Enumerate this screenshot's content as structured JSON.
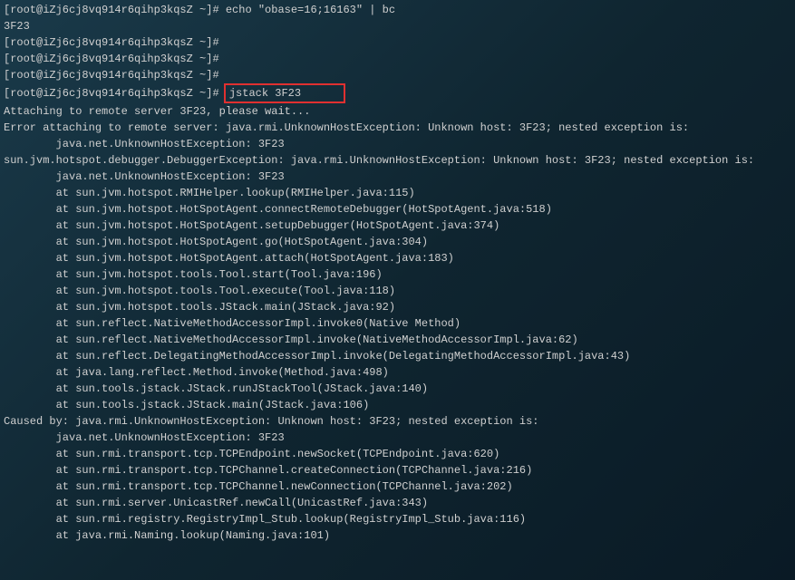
{
  "prompt": {
    "user_host": "[root@iZj6cj8vq914r6qihp3kqsZ ~]#",
    "cmd1": "echo \"obase=16;16163\" | bc",
    "output1": "3F23",
    "highlighted_cmd": "jstack 3F23      "
  },
  "output": {
    "attaching": "Attaching to remote server 3F23, please wait...",
    "error1": "Error attaching to remote server: java.rmi.UnknownHostException: Unknown host: 3F23; nested exception is:",
    "indent_exc": "        java.net.UnknownHostException: 3F23",
    "error2": "sun.jvm.hotspot.debugger.DebuggerException: java.rmi.UnknownHostException: Unknown host: 3F23; nested exception is:",
    "traces": [
      "        at sun.jvm.hotspot.RMIHelper.lookup(RMIHelper.java:115)",
      "        at sun.jvm.hotspot.HotSpotAgent.connectRemoteDebugger(HotSpotAgent.java:518)",
      "        at sun.jvm.hotspot.HotSpotAgent.setupDebugger(HotSpotAgent.java:374)",
      "        at sun.jvm.hotspot.HotSpotAgent.go(HotSpotAgent.java:304)",
      "        at sun.jvm.hotspot.HotSpotAgent.attach(HotSpotAgent.java:183)",
      "        at sun.jvm.hotspot.tools.Tool.start(Tool.java:196)",
      "        at sun.jvm.hotspot.tools.Tool.execute(Tool.java:118)",
      "        at sun.jvm.hotspot.tools.JStack.main(JStack.java:92)",
      "        at sun.reflect.NativeMethodAccessorImpl.invoke0(Native Method)",
      "        at sun.reflect.NativeMethodAccessorImpl.invoke(NativeMethodAccessorImpl.java:62)",
      "        at sun.reflect.DelegatingMethodAccessorImpl.invoke(DelegatingMethodAccessorImpl.java:43)",
      "        at java.lang.reflect.Method.invoke(Method.java:498)",
      "        at sun.tools.jstack.JStack.runJStackTool(JStack.java:140)",
      "        at sun.tools.jstack.JStack.main(JStack.java:106)"
    ],
    "caused_by": "Caused by: java.rmi.UnknownHostException: Unknown host: 3F23; nested exception is:",
    "traces2": [
      "        at sun.rmi.transport.tcp.TCPEndpoint.newSocket(TCPEndpoint.java:620)",
      "        at sun.rmi.transport.tcp.TCPChannel.createConnection(TCPChannel.java:216)",
      "        at sun.rmi.transport.tcp.TCPChannel.newConnection(TCPChannel.java:202)",
      "        at sun.rmi.server.UnicastRef.newCall(UnicastRef.java:343)",
      "        at sun.rmi.registry.RegistryImpl_Stub.lookup(RegistryImpl_Stub.java:116)",
      "        at java.rmi.Naming.lookup(Naming.java:101)"
    ]
  }
}
